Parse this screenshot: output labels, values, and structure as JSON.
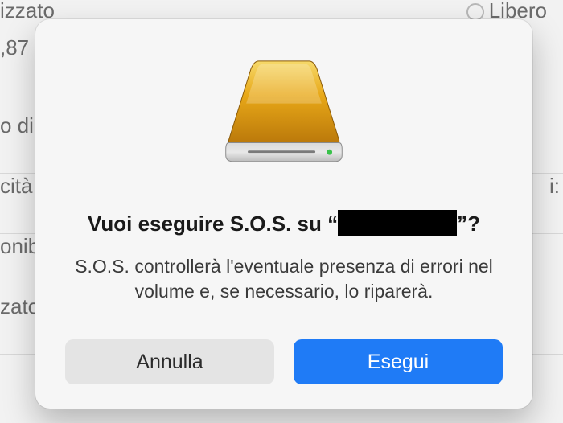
{
  "bg": {
    "left_top": "izzato",
    "right_top": "Libero",
    "value_87": ",87",
    "row_di": "o di",
    "row_cita": "cità",
    "row_onib": "onib",
    "row_zato": "zato",
    "right_i": "i:"
  },
  "dialog": {
    "title_prefix": "Vuoi eseguire S.O.S. su “",
    "title_suffix": "”?",
    "description": "S.O.S. controllerà l'eventuale presenza di errori nel volume e, se necessario, lo riparerà.",
    "cancel": "Annulla",
    "confirm": "Esegui"
  }
}
